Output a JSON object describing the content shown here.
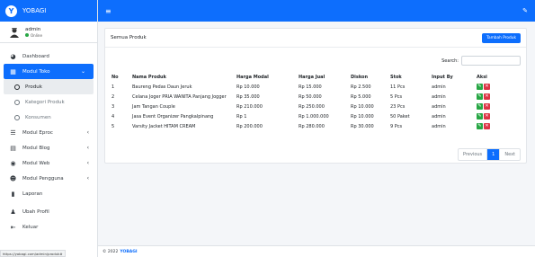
{
  "brand": {
    "name": "YOBAGI",
    "logo_text": "Y"
  },
  "user": {
    "name": "admin",
    "status": "Online"
  },
  "colors": {
    "primary": "#0d6efd",
    "success": "#28a745",
    "danger": "#dc3545"
  },
  "sidebar": {
    "items": [
      {
        "label": "Dashboard",
        "icon": "palette-icon"
      },
      {
        "label": "Modul Toko",
        "icon": "grid-icon"
      },
      {
        "label": "Produk",
        "icon": "circle-icon"
      },
      {
        "label": "Kategori Produk",
        "icon": "circle-icon"
      },
      {
        "label": "Konsumen",
        "icon": "circle-icon"
      },
      {
        "label": "Modul Eproc",
        "icon": "list-icon"
      },
      {
        "label": "Modul Blog",
        "icon": "newspaper-icon"
      },
      {
        "label": "Modul Web",
        "icon": "globe-icon"
      },
      {
        "label": "Modul Pengguna",
        "icon": "users-icon"
      },
      {
        "label": "Laporan",
        "icon": "file-icon"
      },
      {
        "label": "Ubah Profil",
        "icon": "user-icon"
      },
      {
        "label": "Keluar",
        "icon": "logout-icon"
      }
    ]
  },
  "card": {
    "title": "Semua Produk",
    "add_button": "Tambah Produk",
    "search_label": "Search:"
  },
  "table": {
    "headers": [
      "No",
      "Nama Produk",
      "Harga Modal",
      "Harga Jual",
      "Diskon",
      "Stok",
      "Input By",
      "Aksi"
    ],
    "rows": [
      [
        "1",
        "Baureng Pedas Daun Jeruk",
        "Rp 10.000",
        "Rp 15.000",
        "Rp 2.500",
        "11  Pcs",
        "admin"
      ],
      [
        "2",
        "Celana Joger PRIA WANITA Panjang Jogger",
        "Rp 35.000",
        "Rp 50.000",
        "Rp 5.000",
        "5  Pcs",
        "admin"
      ],
      [
        "3",
        "Jam Tangan Couple",
        "Rp 210.000",
        "Rp 250.000",
        "Rp 10.000",
        "23  Pcs",
        "admin"
      ],
      [
        "4",
        "Jasa Event Organizer Pangkalpinang",
        "Rp 1",
        "Rp 1.000.000",
        "Rp 10.000",
        "50  Paket",
        "admin"
      ],
      [
        "5",
        "Varsity Jacket HITAM CREAM",
        "Rp 200.000",
        "Rp 280.000",
        "Rp 30.000",
        "9  Pcs",
        "admin"
      ]
    ]
  },
  "pagination": {
    "previous": "Previous",
    "current": "1",
    "next": "Next"
  },
  "footer": {
    "copyright": "© 2022",
    "brand": "YOBAGI"
  },
  "status_url": "https://yobagi.com/admin/produk#"
}
